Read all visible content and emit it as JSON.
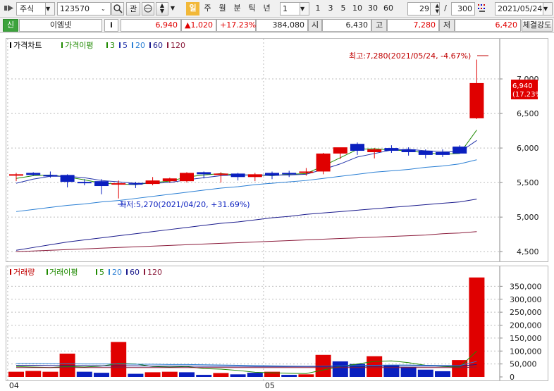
{
  "toolbar": {
    "market_label": "주식",
    "code": "123570",
    "btn_gwan": "관",
    "period_tabs": [
      {
        "label": "일",
        "active": true
      },
      {
        "label": "주",
        "active": false
      },
      {
        "label": "월",
        "active": false
      },
      {
        "label": "분",
        "active": false
      },
      {
        "label": "틱",
        "active": false
      },
      {
        "label": "년",
        "active": false
      }
    ],
    "interval_value": "1",
    "interval_options": [
      "1",
      "3",
      "5",
      "10",
      "30",
      "60"
    ],
    "view_count": "29",
    "separator": "/",
    "total_count": "300",
    "date": "2021/05/24"
  },
  "infobar": {
    "badge": "신",
    "name": "이엠넷",
    "info_button": "i",
    "price": "6,940",
    "change": "▲1,020",
    "change_pct": "+17.23%",
    "volume": "384,080",
    "open_label": "시",
    "open": "6,430",
    "high_label": "고",
    "high": "7,280",
    "low_label": "저",
    "low": "6,420",
    "strength_button": "체결강도"
  },
  "colors": {
    "up": "#e00000",
    "down": "#0a1fbf",
    "ma3": "#1f8a00",
    "ma5": "#2233aa",
    "ma20": "#2a7fd4",
    "ma60": "#1a1a8c",
    "ma120": "#8a1a3a",
    "vol_ma5": "#1f8a00"
  },
  "price_chart": {
    "legend_title": "가격차트",
    "legend_ma": "가격이평",
    "legend_periods": [
      "3",
      "5",
      "20",
      "60",
      "120"
    ],
    "annotation_high": "최고:7,280(2021/05/24, -4.67%)",
    "annotation_low": "최저:5,270(2021/04/20, +31.69%)",
    "current_price_label": "6,940",
    "current_pct_label": "(17.23%)"
  },
  "volume_chart": {
    "legend_title": "거래량",
    "legend_ma": "거래이평",
    "legend_periods": [
      "5",
      "20",
      "60",
      "120"
    ]
  },
  "chart_data": [
    {
      "type": "candlestick",
      "y_ticks": [
        4500,
        5000,
        5500,
        6000,
        6500,
        7000
      ],
      "y_tick_labels": [
        "4,500",
        "5,000",
        "5,500",
        "6,000",
        "6,500",
        "7,000"
      ],
      "ylim": [
        4400,
        7500
      ],
      "x_tick_labels": [
        {
          "label": "04",
          "index": 0
        },
        {
          "label": "05",
          "index": 15
        }
      ],
      "candles": [
        {
          "o": 5620,
          "h": 5640,
          "l": 5520,
          "c": 5620
        },
        {
          "o": 5640,
          "h": 5650,
          "l": 5600,
          "c": 5610
        },
        {
          "o": 5610,
          "h": 5660,
          "l": 5570,
          "c": 5600
        },
        {
          "o": 5610,
          "h": 5620,
          "l": 5430,
          "c": 5510
        },
        {
          "o": 5510,
          "h": 5550,
          "l": 5460,
          "c": 5500
        },
        {
          "o": 5520,
          "h": 5550,
          "l": 5330,
          "c": 5450
        },
        {
          "o": 5490,
          "h": 5530,
          "l": 5270,
          "c": 5490
        },
        {
          "o": 5490,
          "h": 5510,
          "l": 5420,
          "c": 5480
        },
        {
          "o": 5480,
          "h": 5580,
          "l": 5460,
          "c": 5530
        },
        {
          "o": 5520,
          "h": 5570,
          "l": 5500,
          "c": 5560
        },
        {
          "o": 5520,
          "h": 5650,
          "l": 5500,
          "c": 5640
        },
        {
          "o": 5650,
          "h": 5660,
          "l": 5560,
          "c": 5620
        },
        {
          "o": 5620,
          "h": 5650,
          "l": 5500,
          "c": 5630
        },
        {
          "o": 5630,
          "h": 5640,
          "l": 5530,
          "c": 5580
        },
        {
          "o": 5580,
          "h": 5640,
          "l": 5520,
          "c": 5620
        },
        {
          "o": 5640,
          "h": 5660,
          "l": 5550,
          "c": 5600
        },
        {
          "o": 5640,
          "h": 5670,
          "l": 5580,
          "c": 5630
        },
        {
          "o": 5640,
          "h": 5710,
          "l": 5600,
          "c": 5660
        },
        {
          "o": 5660,
          "h": 5930,
          "l": 5620,
          "c": 5920
        },
        {
          "o": 5920,
          "h": 6000,
          "l": 5840,
          "c": 6010
        },
        {
          "o": 6060,
          "h": 6080,
          "l": 5900,
          "c": 5960
        },
        {
          "o": 5940,
          "h": 6000,
          "l": 5850,
          "c": 5980
        },
        {
          "o": 6000,
          "h": 6040,
          "l": 5930,
          "c": 5960
        },
        {
          "o": 5980,
          "h": 6010,
          "l": 5890,
          "c": 5940
        },
        {
          "o": 5960,
          "h": 5980,
          "l": 5850,
          "c": 5900
        },
        {
          "o": 5940,
          "h": 5980,
          "l": 5870,
          "c": 5900
        },
        {
          "o": 6020,
          "h": 6040,
          "l": 5940,
          "c": 5920
        },
        {
          "o": 6430,
          "h": 7280,
          "l": 6420,
          "c": 6940
        }
      ],
      "series": [
        {
          "name": "3",
          "values": [
            5560,
            5600,
            5610,
            5580,
            5540,
            5490,
            5480,
            5470,
            5500,
            5520,
            5580,
            5610,
            5630,
            5610,
            5610,
            5600,
            5620,
            5630,
            5740,
            5860,
            5980,
            5990,
            5970,
            5960,
            5930,
            5910,
            5920,
            6260
          ]
        },
        {
          "name": "5",
          "values": [
            5490,
            5550,
            5590,
            5590,
            5570,
            5530,
            5510,
            5490,
            5490,
            5500,
            5540,
            5570,
            5600,
            5610,
            5610,
            5610,
            5610,
            5620,
            5690,
            5770,
            5870,
            5920,
            5970,
            5980,
            5960,
            5950,
            5940,
            6110
          ]
        },
        {
          "name": "20",
          "values": [
            5080,
            5110,
            5140,
            5170,
            5190,
            5220,
            5240,
            5270,
            5300,
            5330,
            5360,
            5390,
            5420,
            5440,
            5470,
            5490,
            5510,
            5530,
            5560,
            5590,
            5620,
            5650,
            5670,
            5690,
            5720,
            5740,
            5770,
            5830
          ]
        },
        {
          "name": "60",
          "values": [
            4520,
            4560,
            4600,
            4640,
            4670,
            4700,
            4730,
            4760,
            4790,
            4820,
            4850,
            4880,
            4910,
            4930,
            4960,
            4990,
            5010,
            5040,
            5060,
            5080,
            5100,
            5120,
            5140,
            5160,
            5180,
            5200,
            5220,
            5260
          ]
        },
        {
          "name": "120",
          "values": [
            4500,
            4510,
            4520,
            4530,
            4540,
            4550,
            4560,
            4570,
            4580,
            4590,
            4600,
            4610,
            4620,
            4630,
            4640,
            4650,
            4660,
            4670,
            4680,
            4690,
            4700,
            4710,
            4720,
            4730,
            4740,
            4760,
            4770,
            4790
          ]
        }
      ]
    },
    {
      "type": "bar",
      "y_ticks": [
        0,
        50000,
        100000,
        150000,
        200000,
        250000,
        300000,
        350000
      ],
      "y_tick_labels": [
        "0",
        "50,000",
        "100,000",
        "150,000",
        "200,000",
        "250,000",
        "300,000",
        "350,000"
      ],
      "ylim": [
        0,
        400000
      ],
      "values": [
        20000,
        23000,
        20000,
        90000,
        20000,
        16000,
        135000,
        12000,
        18000,
        20000,
        18000,
        8000,
        15000,
        10000,
        16000,
        20000,
        8000,
        10000,
        85000,
        60000,
        50000,
        80000,
        45000,
        38000,
        28000,
        22000,
        65000,
        384080
      ],
      "up": [
        true,
        true,
        true,
        true,
        false,
        false,
        true,
        false,
        true,
        true,
        false,
        false,
        true,
        false,
        false,
        true,
        false,
        true,
        true,
        false,
        false,
        true,
        false,
        false,
        false,
        false,
        true,
        true
      ],
      "series": [
        {
          "name": "5",
          "values": [
            40000,
            38000,
            36000,
            40000,
            38000,
            42000,
            52000,
            50000,
            40000,
            38000,
            40000,
            32000,
            30000,
            25000,
            18000,
            16000,
            14000,
            13000,
            27000,
            40000,
            50000,
            60000,
            62000,
            55000,
            45000,
            40000,
            38000,
            100000
          ]
        },
        {
          "name": "20",
          "values": [
            52000,
            52000,
            51000,
            51000,
            50000,
            50000,
            50000,
            49000,
            49000,
            48000,
            48000,
            47000,
            46000,
            45000,
            44000,
            43000,
            42000,
            41000,
            42000,
            43000,
            44000,
            45000,
            46000,
            46000,
            45000,
            44000,
            44000,
            60000
          ]
        },
        {
          "name": "60",
          "values": [
            45000,
            45000,
            44000,
            44000,
            44000,
            43000,
            43000,
            43000,
            42000,
            42000,
            42000,
            41000,
            41000,
            41000,
            40000,
            40000,
            40000,
            40000,
            40000,
            41000,
            41000,
            41000,
            41000,
            42000,
            42000,
            42000,
            42000,
            48000
          ]
        },
        {
          "name": "120",
          "values": [
            36000,
            36000,
            36000,
            36000,
            36000,
            36000,
            36000,
            36000,
            36000,
            36000,
            36000,
            36000,
            36000,
            36000,
            36000,
            36000,
            36000,
            36000,
            36000,
            36000,
            36000,
            36000,
            36000,
            36000,
            36000,
            36000,
            36000,
            38000
          ]
        }
      ]
    }
  ]
}
